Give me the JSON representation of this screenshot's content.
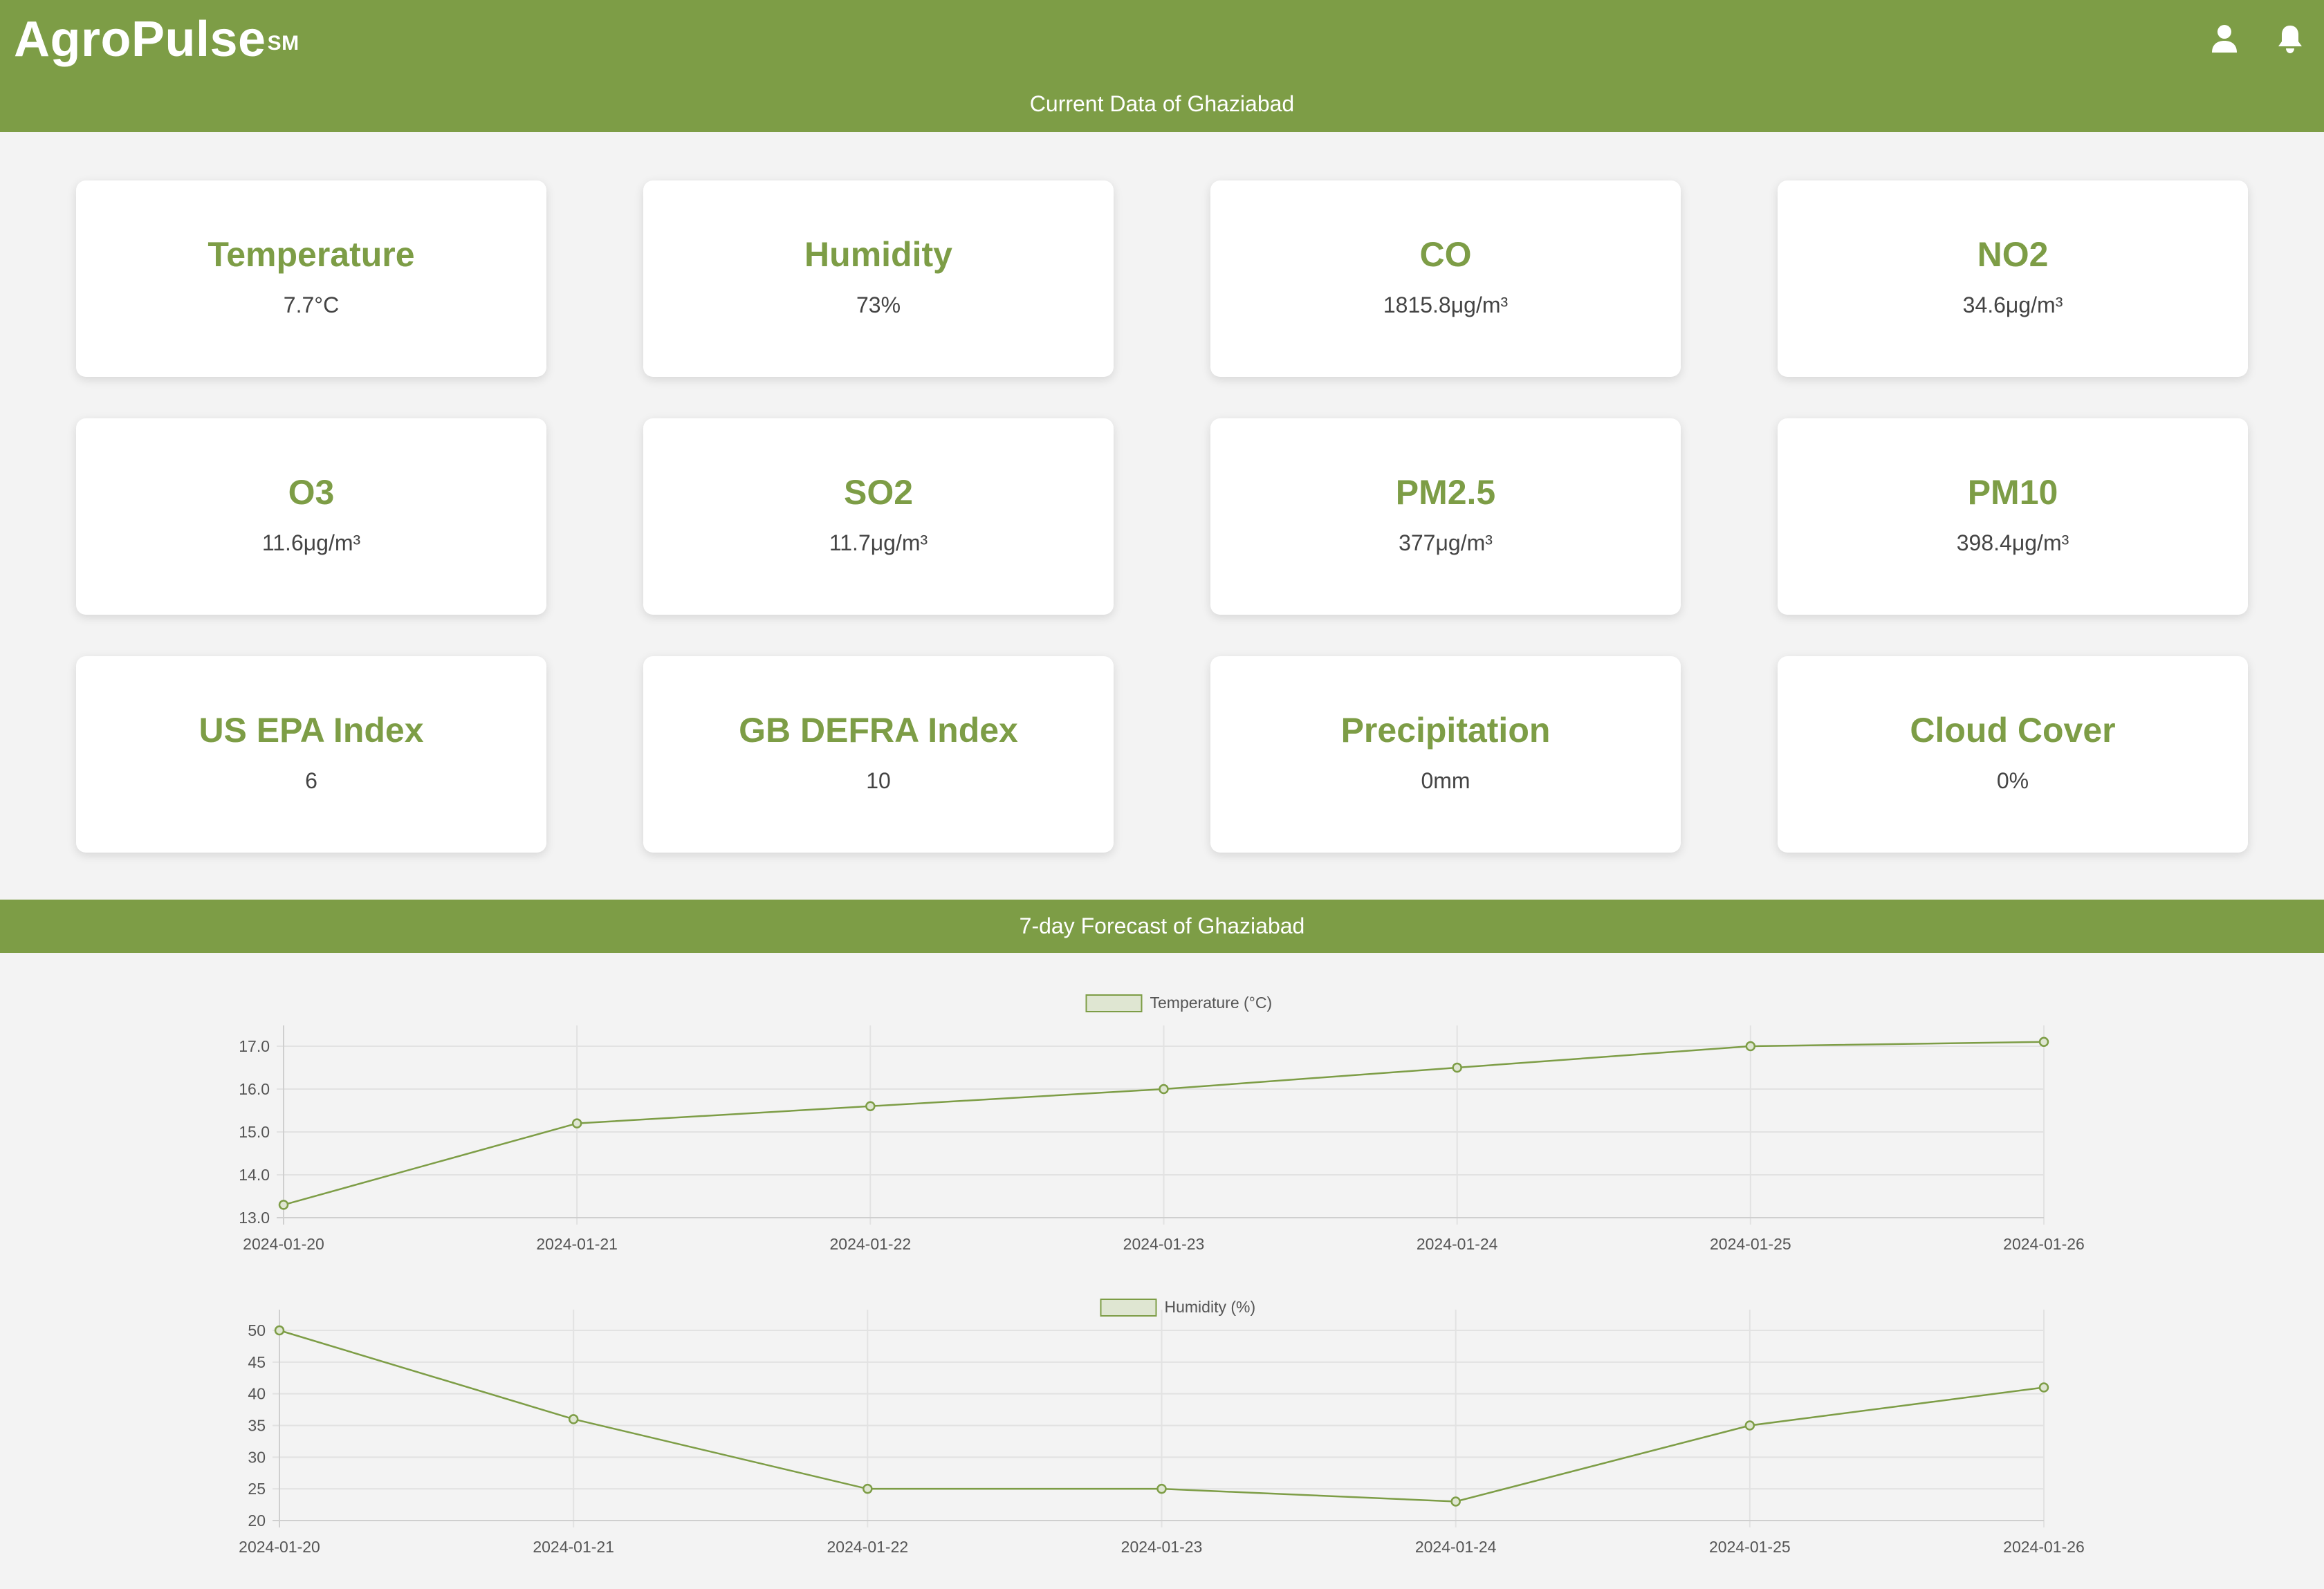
{
  "header": {
    "brand": "AgroPulse",
    "brand_mark": "SM",
    "current_title": "Current Data of Ghaziabad",
    "user_icon": "user-icon",
    "bell_icon": "bell-icon"
  },
  "cards": [
    {
      "title": "Temperature",
      "value": "7.7°C"
    },
    {
      "title": "Humidity",
      "value": "73%"
    },
    {
      "title": "CO",
      "value": "1815.8μg/m³"
    },
    {
      "title": "NO2",
      "value": "34.6μg/m³"
    },
    {
      "title": "O3",
      "value": "11.6μg/m³"
    },
    {
      "title": "SO2",
      "value": "11.7μg/m³"
    },
    {
      "title": "PM2.5",
      "value": "377μg/m³"
    },
    {
      "title": "PM10",
      "value": "398.4μg/m³"
    },
    {
      "title": "US EPA Index",
      "value": "6"
    },
    {
      "title": "GB DEFRA Index",
      "value": "10"
    },
    {
      "title": "Precipitation",
      "value": "0mm"
    },
    {
      "title": "Cloud Cover",
      "value": "0%"
    }
  ],
  "forecast": {
    "title": "7-day Forecast of Ghaziabad"
  },
  "colors": {
    "accent": "#7d9d46",
    "background": "#f3f3f3",
    "card": "#ffffff"
  },
  "chart_data": [
    {
      "type": "line",
      "x": [
        "2024-01-20",
        "2024-01-21",
        "2024-01-22",
        "2024-01-23",
        "2024-01-24",
        "2024-01-25",
        "2024-01-26"
      ],
      "series": [
        {
          "name": "Temperature (°C)",
          "values": [
            13.3,
            15.2,
            15.6,
            16.0,
            16.5,
            17.0,
            17.1
          ]
        }
      ],
      "ylim": [
        13.0,
        17.0
      ],
      "yticks": [
        "13.0",
        "14.0",
        "15.0",
        "16.0",
        "17.0"
      ],
      "grid": true,
      "legend": "top-center"
    },
    {
      "type": "line",
      "x": [
        "2024-01-20",
        "2024-01-21",
        "2024-01-22",
        "2024-01-23",
        "2024-01-24",
        "2024-01-25",
        "2024-01-26"
      ],
      "series": [
        {
          "name": "Humidity (%)",
          "values": [
            50,
            36,
            25,
            25,
            23,
            35,
            41
          ]
        }
      ],
      "ylim": [
        20,
        50
      ],
      "yticks": [
        "20",
        "25",
        "30",
        "35",
        "40",
        "45",
        "50"
      ],
      "grid": true,
      "legend": "top-center"
    }
  ]
}
